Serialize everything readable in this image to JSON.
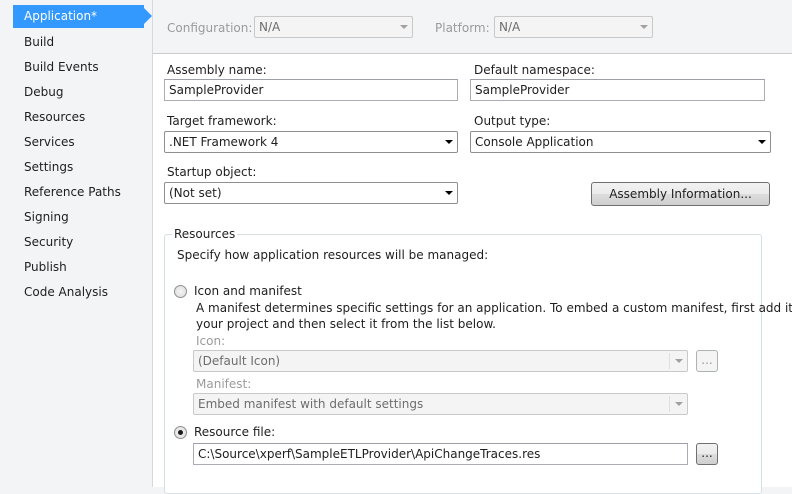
{
  "sidebar": {
    "active": "Application*",
    "items": [
      "Build",
      "Build Events",
      "Debug",
      "Resources",
      "Services",
      "Settings",
      "Reference Paths",
      "Signing",
      "Security",
      "Publish",
      "Code Analysis"
    ]
  },
  "topbar": {
    "configuration_label": "Configuration:",
    "configuration_value": "N/A",
    "platform_label": "Platform:",
    "platform_value": "N/A"
  },
  "form": {
    "assembly_name_label": "Assembly name:",
    "assembly_name_value": "SampleProvider",
    "default_namespace_label": "Default namespace:",
    "default_namespace_value": "SampleProvider",
    "target_framework_label": "Target framework:",
    "target_framework_value": ".NET Framework 4",
    "output_type_label": "Output type:",
    "output_type_value": "Console Application",
    "startup_object_label": "Startup object:",
    "startup_object_value": "(Not set)",
    "assembly_info_button": "Assembly Information..."
  },
  "resources": {
    "group_title": "Resources",
    "intro": "Specify how application resources will be managed:",
    "icon_manifest_label": "Icon and manifest",
    "icon_manifest_desc_1": "A manifest determines specific settings for an application. To embed a custom manifest, first add it to",
    "icon_manifest_desc_2": "your project and then select it from the list below.",
    "icon_label": "Icon:",
    "icon_value": "(Default Icon)",
    "browse_label": "...",
    "manifest_label": "Manifest:",
    "manifest_value": "Embed manifest with default settings",
    "resource_file_label": "Resource file:",
    "resource_file_value": "C:\\Source\\xperf\\SampleETLProvider\\ApiChangeTraces.res",
    "resource_browse_label": "...",
    "selected_option": "resource-file"
  }
}
